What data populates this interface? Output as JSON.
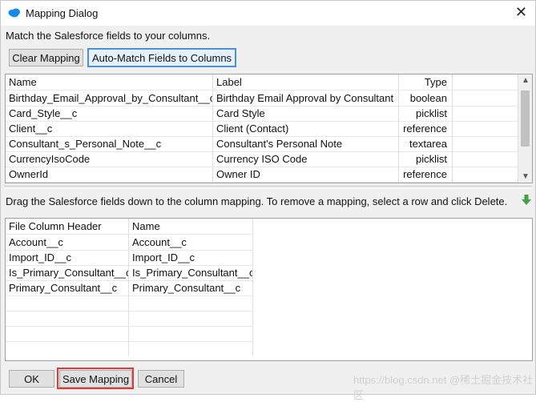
{
  "window": {
    "title": "Mapping Dialog",
    "close_glyph": "✕"
  },
  "instructions": "Match the Salesforce fields to your columns.",
  "toolbar": {
    "clear_label": "Clear Mapping",
    "automatch_label": "Auto-Match Fields to Columns"
  },
  "fields_table": {
    "headers": [
      "Name",
      "Label",
      "Type"
    ],
    "rows": [
      [
        "Birthday_Email_Approval_by_Consultant__c",
        "Birthday Email Approval by Consultant",
        "boolean"
      ],
      [
        "Card_Style__c",
        "Card Style",
        "picklist"
      ],
      [
        "Client__c",
        "Client (Contact)",
        "reference"
      ],
      [
        "Consultant_s_Personal_Note__c",
        "Consultant's Personal Note",
        "textarea"
      ],
      [
        "CurrencyIsoCode",
        "Currency ISO Code",
        "picklist"
      ],
      [
        "OwnerId",
        "Owner ID",
        "reference"
      ]
    ]
  },
  "drag_instruction": "Drag the Salesforce fields down to the column mapping.  To remove a mapping, select a row and click Delete.",
  "mapping_table": {
    "headers": [
      "File Column Header",
      "Name"
    ],
    "rows": [
      [
        "Account__c",
        "Account__c"
      ],
      [
        "Import_ID__c",
        "Import_ID__c"
      ],
      [
        "Is_Primary_Consultant__c",
        "Is_Primary_Consultant__c"
      ],
      [
        "Primary_Consultant__c",
        "Primary_Consultant__c"
      ]
    ]
  },
  "footer": {
    "ok_label": "OK",
    "save_label": "Save Mapping",
    "cancel_label": "Cancel"
  },
  "watermark": "https://blog.csdn.net @稀土掘金技术社区",
  "colors": {
    "highlight": "#e53935",
    "focus": "#4a90d9",
    "arrow": "#43a047",
    "app_icon": "#1589ee"
  },
  "icons": {
    "app": "salesforce-cloud-icon",
    "drag": "green-down-arrow-icon"
  }
}
